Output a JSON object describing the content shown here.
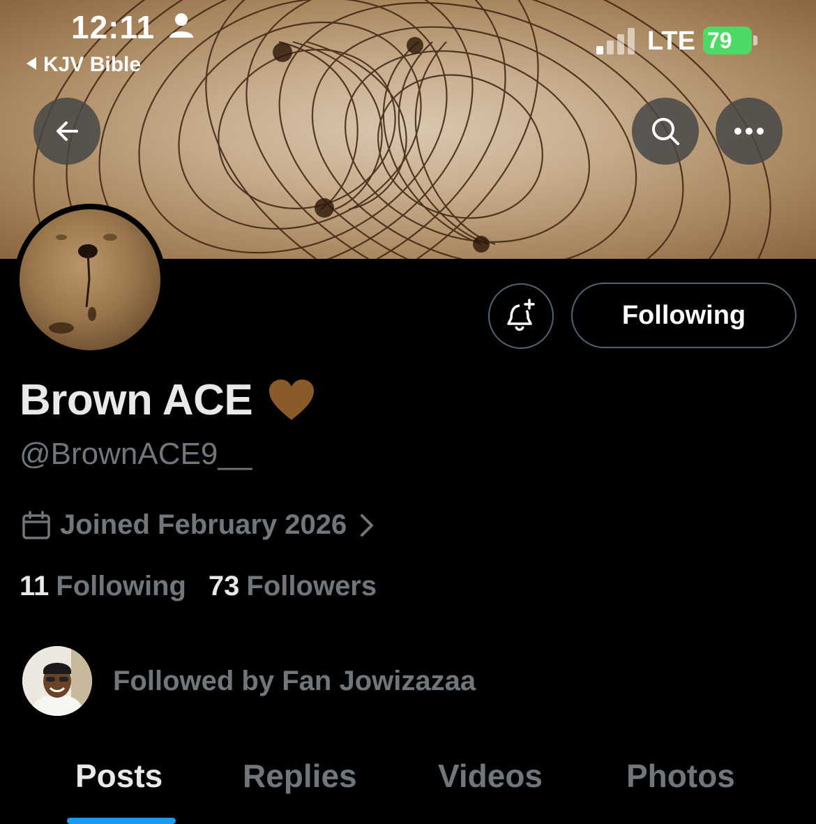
{
  "status_bar": {
    "time": "12:11",
    "back_app": "KJV Bible",
    "network": "LTE",
    "battery": "79"
  },
  "header": {
    "back_icon": "arrow-left-icon",
    "search_icon": "search-icon",
    "more_icon": "more-horizontal-icon"
  },
  "profile": {
    "display_name": "Brown ACE",
    "name_emoji": "brown-heart-icon",
    "handle": "@BrownACE9__",
    "joined": "Joined February 2026",
    "following_count": "11",
    "following_label": "Following",
    "followers_count": "73",
    "followers_label": "Followers",
    "followed_by": "Followed by Fan Jowizazaa"
  },
  "actions": {
    "notify_icon": "bell-plus-icon",
    "follow_button": "Following"
  },
  "tabs": [
    {
      "label": "Posts",
      "active": true
    },
    {
      "label": "Replies",
      "active": false
    },
    {
      "label": "Videos",
      "active": false
    },
    {
      "label": "Photos",
      "active": false
    }
  ],
  "colors": {
    "accent": "#1d9bf0",
    "secondary_text": "#71767b",
    "heart": "#8b5a2b",
    "battery": "#4cd964"
  }
}
